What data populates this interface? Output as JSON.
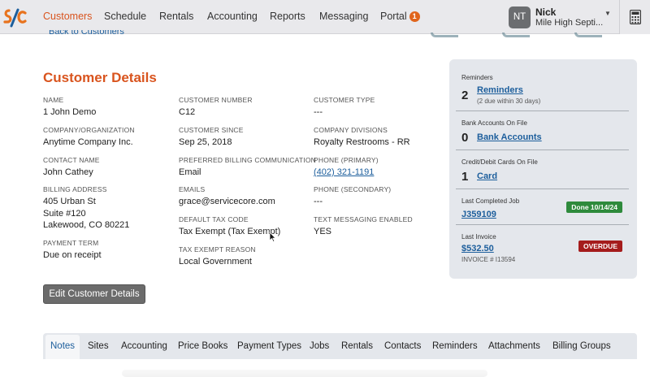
{
  "nav": {
    "items": [
      {
        "label": "Customers",
        "active": true
      },
      {
        "label": "Schedule"
      },
      {
        "label": "Rentals"
      },
      {
        "label": "Accounting"
      },
      {
        "label": "Reports"
      },
      {
        "label": "Messaging"
      },
      {
        "label": "Portal",
        "badge": "1"
      }
    ],
    "user": {
      "initials": "NT",
      "name": "Nick",
      "org": "Mile High Septi..."
    },
    "calculator_icon": "calculator-icon"
  },
  "back_link": "Back to Customers",
  "details": {
    "title": "Customer Details",
    "fields": {
      "name": {
        "label": "NAME",
        "value": "1 John Demo"
      },
      "company": {
        "label": "COMPANY/ORGANIZATION",
        "value": "Anytime Company Inc."
      },
      "contact": {
        "label": "CONTACT NAME",
        "value": "John Cathey"
      },
      "billing": {
        "label": "BILLING ADDRESS",
        "line1": "405 Urban St",
        "line2": "Suite #120",
        "line3": "Lakewood, CO 80221"
      },
      "payment_term": {
        "label": "PAYMENT TERM",
        "value": "Due on receipt"
      },
      "customer_number": {
        "label": "CUSTOMER NUMBER",
        "value": "C12"
      },
      "customer_since": {
        "label": "CUSTOMER SINCE",
        "value": "Sep 25, 2018"
      },
      "billing_comm": {
        "label": "PREFERRED BILLING COMMUNICATION",
        "value": "Email"
      },
      "emails": {
        "label": "EMAILS",
        "value": "grace@servicecore.com"
      },
      "tax_code": {
        "label": "DEFAULT TAX CODE",
        "value": "Tax Exempt (Tax Exempt)"
      },
      "tax_reason": {
        "label": "TAX EXEMPT REASON",
        "value": "Local Government"
      },
      "customer_type": {
        "label": "CUSTOMER TYPE",
        "value": "---"
      },
      "divisions": {
        "label": "COMPANY DIVISIONS",
        "value": "Royalty Restrooms - RR"
      },
      "phone_primary": {
        "label": "PHONE (PRIMARY)",
        "value": "(402) 321-1191"
      },
      "phone_secondary": {
        "label": "PHONE (SECONDARY)",
        "value": "---"
      },
      "texting": {
        "label": "TEXT MESSAGING ENABLED",
        "value": "YES"
      }
    },
    "edit_button": "Edit Customer Details"
  },
  "panel": {
    "reminders": {
      "label": "Reminders",
      "count": "2",
      "link": "Reminders",
      "sub": "(2 due within 30 days)"
    },
    "bank": {
      "label": "Bank Accounts On File",
      "count": "0",
      "link": "Bank Accounts"
    },
    "cards": {
      "label": "Credit/Debit Cards On File",
      "count": "1",
      "link": "Card"
    },
    "last_job": {
      "label": "Last Completed Job",
      "link": "J359109",
      "status": "Done 10/14/24",
      "status_color": "#2e8a3c"
    },
    "last_invoice": {
      "label": "Last Invoice",
      "link": "$532.50",
      "sub": "INVOICE # I13594",
      "status": "OVERDUE",
      "status_color": "#a51c1c"
    }
  },
  "tabs": [
    "Notes",
    "Sites",
    "Accounting",
    "Price Books",
    "Payment Types",
    "Jobs",
    "Rentals",
    "Contacts",
    "Reminders",
    "Attachments",
    "Billing Groups"
  ],
  "active_tab": "Notes",
  "colors": {
    "accent": "#d9541e",
    "link": "#1c5e9c",
    "panel_bg": "#e4e7ec"
  }
}
